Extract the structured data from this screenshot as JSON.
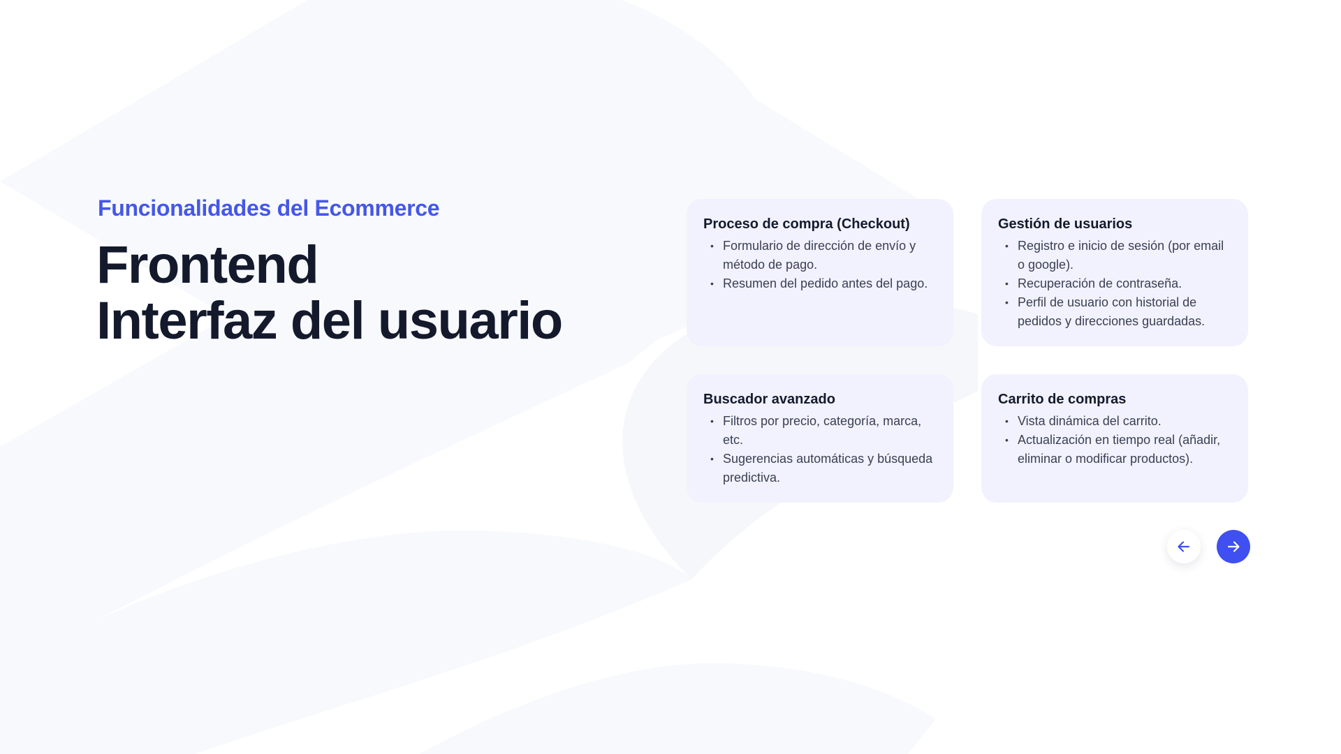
{
  "eyebrow": "Funcionalidades del Ecommerce",
  "headline": {
    "line1": "Frontend",
    "line2": "Interfaz del usuario"
  },
  "cards": [
    {
      "title": "Proceso de compra (Checkout)",
      "items": [
        "Formulario de dirección de envío y método de pago.",
        "Resumen del pedido antes del pago."
      ]
    },
    {
      "title": "Gestión de usuarios",
      "items": [
        "Registro e inicio de sesión (por email o google).",
        "Recuperación de contraseña.",
        "Perfil de usuario con historial de pedidos y direcciones guardadas."
      ]
    },
    {
      "title": "Buscador avanzado",
      "items": [
        "Filtros por precio, categoría, marca, etc.",
        "Sugerencias automáticas y búsqueda predictiva."
      ]
    },
    {
      "title": "Carrito de compras",
      "items": [
        "Vista dinámica del carrito.",
        "Actualización en tiempo real (añadir, eliminar o modificar productos)."
      ]
    }
  ],
  "navigation": {
    "prev_icon": "arrow-left-icon",
    "next_icon": "arrow-right-icon"
  },
  "colors": {
    "accent": "#4557e8",
    "heading": "#141a2c",
    "card_background": "#f1f2fd",
    "next_button": "#3f4ff0"
  }
}
